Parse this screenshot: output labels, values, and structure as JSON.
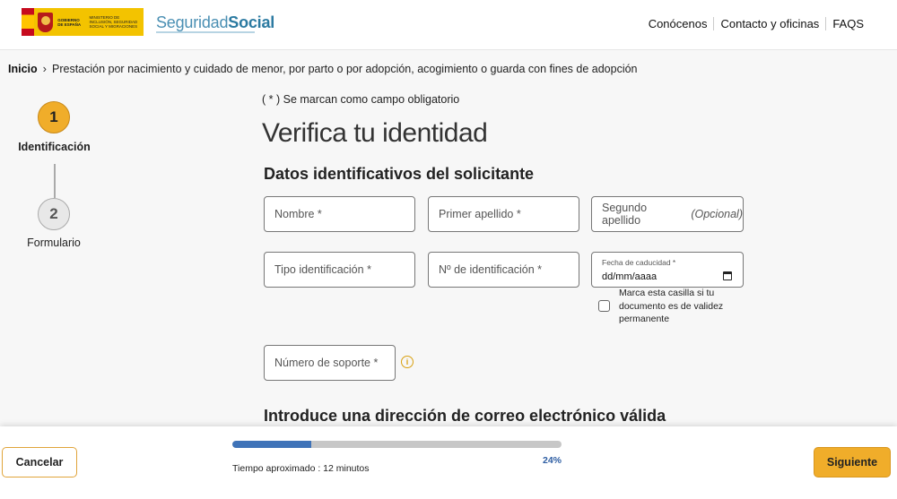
{
  "header": {
    "gov_logo_text_1": "GOBIERNO DE ESPAÑA",
    "gov_logo_text_2": "MINISTERIO DE INCLUSIÓN, SEGURIDAD SOCIAL Y MIGRACIONES",
    "brand_light": "Seguridad",
    "brand_bold": "Social",
    "nav": [
      "Conócenos",
      "Contacto y oficinas",
      "FAQS"
    ]
  },
  "breadcrumb": {
    "home": "Inicio",
    "current": "Prestación por nacimiento y cuidado de menor, por parto o por adopción, acogimiento o guarda con fines de adopción"
  },
  "steps": [
    {
      "number": "1",
      "label": "Identificación",
      "state": "active"
    },
    {
      "number": "2",
      "label": "Formulario",
      "state": "pending"
    }
  ],
  "form": {
    "required_note": "( * ) Se marcan como campo obligatorio",
    "title": "Verifica tu identidad",
    "section1_title": "Datos identificativos del solicitante",
    "fields": {
      "nombre": "Nombre  *",
      "primer_apellido": "Primer apellido  *",
      "segundo_apellido": "Segundo apellido",
      "segundo_apellido_opt": "(Opcional)",
      "tipo_identificacion": "Tipo identificación  *",
      "num_identificacion": "Nº de identificación  *",
      "fecha_caducidad_label": "Fecha de caducidad  *",
      "fecha_caducidad_placeholder": "dd/mm/aaaa",
      "numero_soporte": "Número de soporte  *"
    },
    "checkbox_label": "Marca esta casilla si tu documento es de validez permanente",
    "checkbox_checked": false,
    "section2_title": "Introduce una dirección de correo electrónico válida"
  },
  "footer": {
    "cancel_label": "Cancelar",
    "next_label": "Siguiente",
    "progress_percent": 24,
    "progress_text": "24%",
    "time_estimate": "Tiempo aproximado : 12 minutos"
  },
  "colors": {
    "accent": "#f0ad2a",
    "progress": "#3f73b8",
    "brand": "#2b7aa1"
  }
}
